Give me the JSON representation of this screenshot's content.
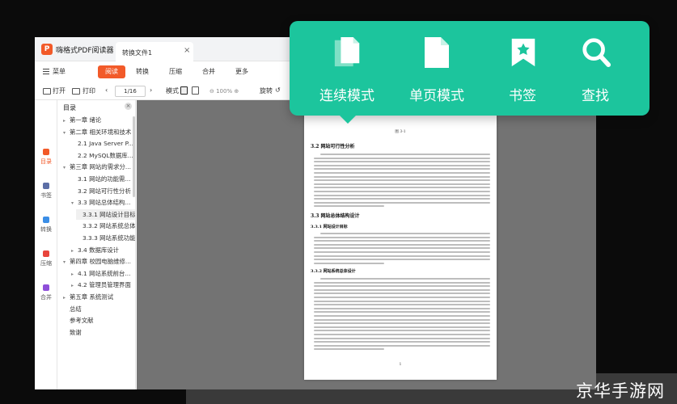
{
  "app": {
    "logo_letter": "P",
    "title": "嗨格式PDF阅读器",
    "tab_label": "转换文件1",
    "tab_close": "×"
  },
  "menu": {
    "menu_label": "菜单",
    "items": [
      "阅读",
      "转换",
      "压缩",
      "合并",
      "更多"
    ]
  },
  "toolbar": {
    "open": "打开",
    "print": "打印",
    "page": "1/16",
    "mode": "模式",
    "zoom": "100%",
    "rotate": "旋转"
  },
  "left_rail": [
    "目录",
    "书签",
    "转换",
    "压缩",
    "合并"
  ],
  "toc": {
    "header": "目录",
    "items": [
      {
        "label": "第一章 绪论",
        "arrow": "▸"
      },
      {
        "label": "第二章 相关环境和技术",
        "arrow": "▾"
      },
      {
        "label": "2.1 Java Server P...",
        "arrow": ""
      },
      {
        "label": "2.2 MySQL数据库...",
        "arrow": ""
      },
      {
        "label": "第三章 网站的需求分...",
        "arrow": "▾"
      },
      {
        "label": "3.1 网站的功能需...",
        "arrow": ""
      },
      {
        "label": "3.2 网站可行性分析",
        "arrow": ""
      },
      {
        "label": "3.3 网站总体结构...",
        "arrow": "▾"
      },
      {
        "label": "3.3.1 网站设计目标",
        "arrow": ""
      },
      {
        "label": "3.3.2 网站系统总体...",
        "arrow": ""
      },
      {
        "label": "3.3.3 网站系统功能...",
        "arrow": ""
      },
      {
        "label": "3.4 数据库设计",
        "arrow": "▸"
      },
      {
        "label": "第四章 校园电脑维修...",
        "arrow": "▾"
      },
      {
        "label": "4.1 网站系统前台...",
        "arrow": "▸"
      },
      {
        "label": "4.2 管理员管理界面",
        "arrow": "▸"
      },
      {
        "label": "第五章 系统测试",
        "arrow": "▸"
      },
      {
        "label": "总结",
        "arrow": ""
      },
      {
        "label": "参考文献",
        "arrow": ""
      },
      {
        "label": "致谢",
        "arrow": ""
      }
    ]
  },
  "page": {
    "caption": "图 3-1",
    "h1": "3.2 网站可行性分析",
    "h2": "3.3 网站总体结构设计",
    "h3": "3.3.1 网站设计目标",
    "h4": "3.3.2 网站系统总体设计",
    "page_number": "1"
  },
  "popup": {
    "buttons": [
      {
        "label": "连续模式",
        "icon": "double-doc-icon"
      },
      {
        "label": "单页模式",
        "icon": "single-doc-icon"
      },
      {
        "label": "书签",
        "icon": "bookmark-icon"
      },
      {
        "label": "查找",
        "icon": "search-icon"
      }
    ]
  },
  "watermark": "京华手游网",
  "colors": {
    "accent": "#f25a29",
    "popup": "#1cc59d",
    "viewer_bg": "#737373"
  }
}
